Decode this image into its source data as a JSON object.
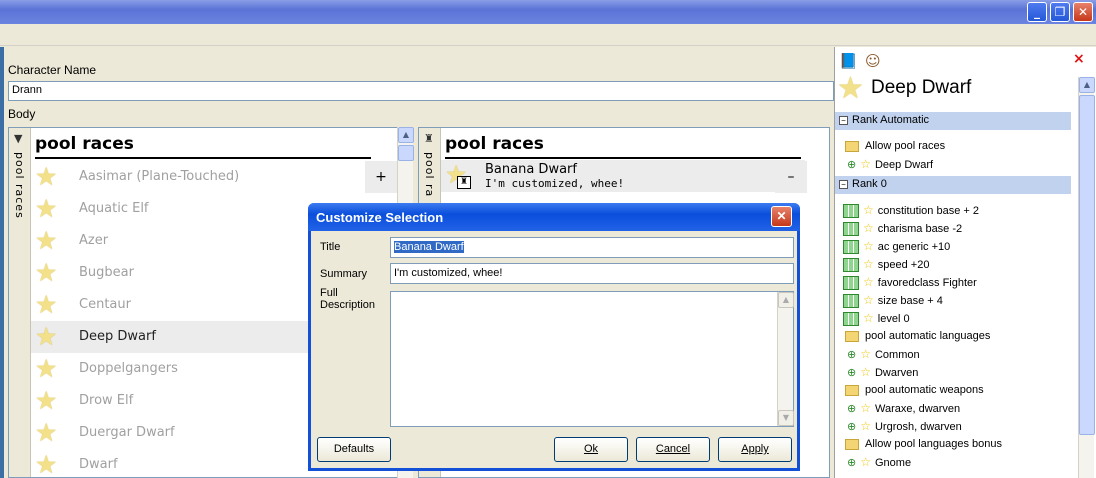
{
  "window": {
    "minimize_label": "_",
    "maximize_label": "❐",
    "close_label": "✕"
  },
  "editor": {
    "character_name_label": "Character Name",
    "character_name_value": "Drann",
    "body_label": "Body"
  },
  "left_pool": {
    "tab_label": "pool races",
    "header": "pool races",
    "add_label": "+",
    "races": [
      "Aasimar (Plane-Touched)",
      "Aquatic Elf",
      "Azer",
      "Bugbear",
      "Centaur",
      "Deep Dwarf",
      "Doppelgangers",
      "Drow Elf",
      "Duergar Dwarf",
      "Dwarf"
    ],
    "selected_race": "Deep Dwarf"
  },
  "right_pool": {
    "tab_label": "pool ra",
    "header": "pool races",
    "item_title": "Banana Dwarf",
    "item_summary": "I'm customized, whee!",
    "remove_label": "–"
  },
  "dialog": {
    "title": "Customize Selection",
    "title_label": "Title",
    "title_value": "Banana Dwarf",
    "summary_label": "Summary",
    "summary_value": "I'm customized, whee!",
    "full_description_label_1": "Full",
    "full_description_label_2": "Description",
    "full_description_value": "",
    "defaults_label": "Defaults",
    "ok_label": "Ok",
    "cancel_label": "Cancel",
    "apply_label": "Apply",
    "close_label": "✕"
  },
  "detail_panel": {
    "title": "Deep Dwarf",
    "close_label": "×",
    "rank_automatic": {
      "label": "Rank Automatic",
      "items": [
        {
          "type": "folder",
          "text": "Allow pool races"
        },
        {
          "type": "leaf",
          "text": "Deep Dwarf"
        }
      ]
    },
    "rank_0": {
      "label": "Rank 0",
      "items": [
        {
          "type": "grid",
          "text": "constitution base + 2"
        },
        {
          "type": "grid",
          "text": "charisma base -2"
        },
        {
          "type": "grid",
          "text": "ac generic +10"
        },
        {
          "type": "grid",
          "text": "speed +20"
        },
        {
          "type": "grid",
          "text": "favoredclass Fighter"
        },
        {
          "type": "grid",
          "text": "size base + 4"
        },
        {
          "type": "grid",
          "text": "level  0"
        },
        {
          "type": "folder",
          "text": "pool automatic languages"
        },
        {
          "type": "leaf",
          "text": "Common"
        },
        {
          "type": "leaf",
          "text": "Dwarven"
        },
        {
          "type": "folder",
          "text": "pool automatic weapons"
        },
        {
          "type": "leaf",
          "text": "Waraxe, dwarven"
        },
        {
          "type": "leaf",
          "text": "Urgrosh, dwarven"
        },
        {
          "type": "folder",
          "text": "Allow pool languages bonus"
        },
        {
          "type": "leaf",
          "text": "Gnome"
        }
      ]
    }
  }
}
